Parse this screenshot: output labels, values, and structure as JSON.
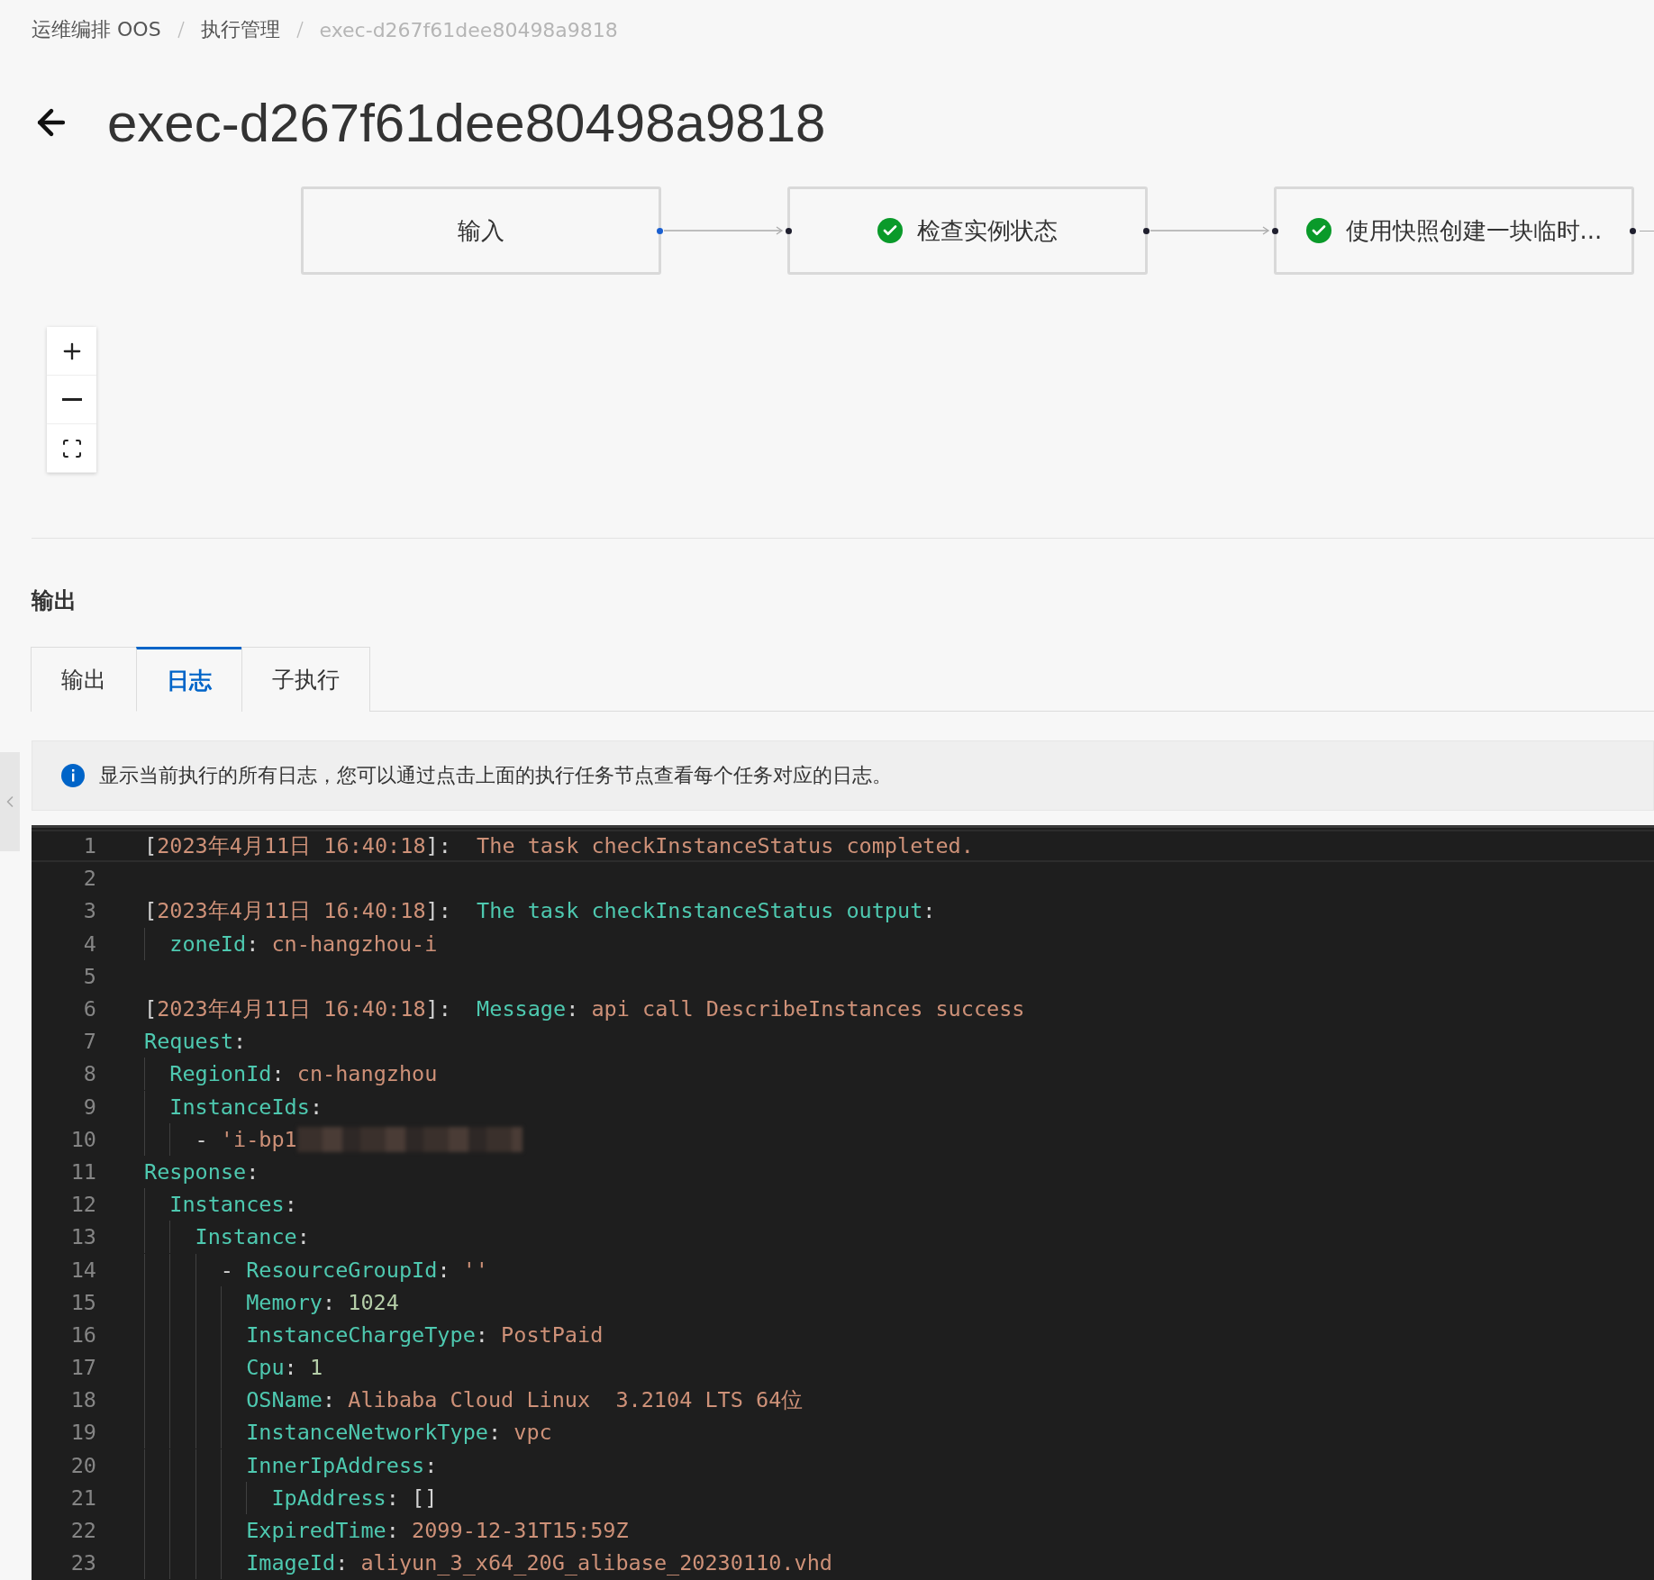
{
  "breadcrumb": [
    {
      "label": "运维编排 OOS",
      "current": false
    },
    {
      "label": "执行管理",
      "current": false
    },
    {
      "label": "exec-d267f61dee80498a9818",
      "current": true
    }
  ],
  "title": "exec-d267f61dee80498a9818",
  "flow": {
    "nodes": [
      {
        "label": "输入",
        "done": false,
        "color": "#1a5fd0"
      },
      {
        "label": "检查实例状态",
        "done": true,
        "color": "#1f1f2e"
      },
      {
        "label": "使用快照创建一块临时...",
        "done": true,
        "color": "#1f1f2e"
      }
    ]
  },
  "output": {
    "heading": "输出",
    "tabs": [
      {
        "label": "输出",
        "selected": false
      },
      {
        "label": "日志",
        "selected": true
      },
      {
        "label": "子执行",
        "selected": false
      }
    ],
    "notice": "显示当前执行的所有日志，您可以通过点击上面的执行任务节点查看每个任务对应的日志。",
    "log_lines": [
      {
        "n": "1",
        "highlighted": true,
        "tokens": [
          {
            "t": "[",
            "kind": "punct"
          },
          {
            "t": "2023年4月11日 16:40:18",
            "kind": "string"
          },
          {
            "t": "]:",
            "kind": "punct"
          },
          {
            "t": "  The task checkInstanceStatus completed.",
            "kind": "string"
          }
        ]
      },
      {
        "n": "2",
        "highlighted": false
      },
      {
        "n": "3",
        "highlighted": false,
        "tokens": [
          {
            "t": "[",
            "kind": "punct"
          },
          {
            "t": "2023年4月11日 16:40:18",
            "kind": "string"
          },
          {
            "t": "]:",
            "kind": "punct"
          },
          {
            "t": "  The task checkInstanceStatus output",
            "kind": "key"
          },
          {
            "t": ":",
            "kind": "punct"
          }
        ],
        "children": [
          {
            "n": "4",
            "highlighted": false,
            "tokens": [
              {
                "t": "zoneId",
                "kind": "key"
              },
              {
                "t": ": ",
                "kind": "punct"
              },
              {
                "t": "cn-hangzhou-i",
                "kind": "string"
              }
            ]
          }
        ]
      },
      {
        "n": "5",
        "highlighted": false
      },
      {
        "n": "6",
        "highlighted": false,
        "tokens": [
          {
            "t": "[",
            "kind": "punct"
          },
          {
            "t": "2023年4月11日 16:40:18",
            "kind": "string"
          },
          {
            "t": "]:",
            "kind": "punct"
          },
          {
            "t": "  Message",
            "kind": "key"
          },
          {
            "t": ": ",
            "kind": "punct"
          },
          {
            "t": "api call DescribeInstances success",
            "kind": "string"
          }
        ]
      },
      {
        "n": "7",
        "highlighted": false,
        "tokens": [
          {
            "t": "Request",
            "kind": "key"
          },
          {
            "t": ":",
            "kind": "punct"
          }
        ],
        "children": [
          {
            "n": "8",
            "highlighted": false,
            "tokens": [
              {
                "t": "RegionId",
                "kind": "key"
              },
              {
                "t": ": ",
                "kind": "punct"
              },
              {
                "t": "cn-hangzhou",
                "kind": "string"
              }
            ]
          },
          {
            "n": "9",
            "highlighted": false,
            "tokens": [
              {
                "t": "InstanceIds",
                "kind": "key"
              },
              {
                "t": ":",
                "kind": "punct"
              }
            ],
            "children": [
              {
                "n": "10",
                "highlighted": false,
                "redacted": true,
                "tokens": [
                  {
                    "t": "- ",
                    "kind": "punct"
                  },
                  {
                    "t": "'i-bp1",
                    "kind": "string"
                  }
                ]
              }
            ]
          }
        ]
      },
      {
        "n": "11",
        "highlighted": false,
        "tokens": [
          {
            "t": "Response",
            "kind": "key"
          },
          {
            "t": ":",
            "kind": "punct"
          }
        ],
        "children": [
          {
            "n": "12",
            "highlighted": false,
            "tokens": [
              {
                "t": "Instances",
                "kind": "key"
              },
              {
                "t": ":",
                "kind": "punct"
              }
            ],
            "children": [
              {
                "n": "13",
                "highlighted": false,
                "tokens": [
                  {
                    "t": "Instance",
                    "kind": "key"
                  },
                  {
                    "t": ":",
                    "kind": "punct"
                  }
                ],
                "children": [
                  {
                    "n": "14",
                    "highlighted": false,
                    "tokens": [
                      {
                        "t": "- ",
                        "kind": "punct"
                      },
                      {
                        "t": "ResourceGroupId",
                        "kind": "key"
                      },
                      {
                        "t": ": ",
                        "kind": "punct"
                      },
                      {
                        "t": "''",
                        "kind": "string"
                      }
                    ],
                    "children": [
                      {
                        "n": "15",
                        "highlighted": false,
                        "tokens": [
                          {
                            "t": "Memory",
                            "kind": "key"
                          },
                          {
                            "t": ": ",
                            "kind": "punct"
                          },
                          {
                            "t": "1024",
                            "kind": "number"
                          }
                        ]
                      },
                      {
                        "n": "16",
                        "highlighted": false,
                        "tokens": [
                          {
                            "t": "InstanceChargeType",
                            "kind": "key"
                          },
                          {
                            "t": ": ",
                            "kind": "punct"
                          },
                          {
                            "t": "PostPaid",
                            "kind": "string"
                          }
                        ]
                      },
                      {
                        "n": "17",
                        "highlighted": false,
                        "tokens": [
                          {
                            "t": "Cpu",
                            "kind": "key"
                          },
                          {
                            "t": ": ",
                            "kind": "punct"
                          },
                          {
                            "t": "1",
                            "kind": "number"
                          }
                        ]
                      },
                      {
                        "n": "18",
                        "highlighted": false,
                        "tokens": [
                          {
                            "t": "OSName",
                            "kind": "key"
                          },
                          {
                            "t": ": ",
                            "kind": "punct"
                          },
                          {
                            "t": "Alibaba Cloud Linux  3.2104 LTS 64位",
                            "kind": "string"
                          }
                        ]
                      },
                      {
                        "n": "19",
                        "highlighted": false,
                        "tokens": [
                          {
                            "t": "InstanceNetworkType",
                            "kind": "key"
                          },
                          {
                            "t": ": ",
                            "kind": "punct"
                          },
                          {
                            "t": "vpc",
                            "kind": "string"
                          }
                        ]
                      },
                      {
                        "n": "20",
                        "highlighted": false,
                        "tokens": [
                          {
                            "t": "InnerIpAddress",
                            "kind": "key"
                          },
                          {
                            "t": ":",
                            "kind": "punct"
                          }
                        ],
                        "children": [
                          {
                            "n": "21",
                            "highlighted": false,
                            "tokens": [
                              {
                                "t": "IpAddress",
                                "kind": "key"
                              },
                              {
                                "t": ": ",
                                "kind": "punct"
                              },
                              {
                                "t": "[]",
                                "kind": "punct"
                              }
                            ]
                          }
                        ]
                      },
                      {
                        "n": "22",
                        "highlighted": false,
                        "tokens": [
                          {
                            "t": "ExpiredTime",
                            "kind": "key"
                          },
                          {
                            "t": ": ",
                            "kind": "punct"
                          },
                          {
                            "t": "2099-12-31T15:59Z",
                            "kind": "string"
                          }
                        ]
                      },
                      {
                        "n": "23",
                        "highlighted": false,
                        "tokens": [
                          {
                            "t": "ImageId",
                            "kind": "key"
                          },
                          {
                            "t": ": ",
                            "kind": "punct"
                          },
                          {
                            "t": "aliyun_3_x64_20G_alibase_20230110.vhd",
                            "kind": "string"
                          }
                        ]
                      }
                    ]
                  }
                ]
              }
            ]
          }
        ]
      }
    ]
  }
}
